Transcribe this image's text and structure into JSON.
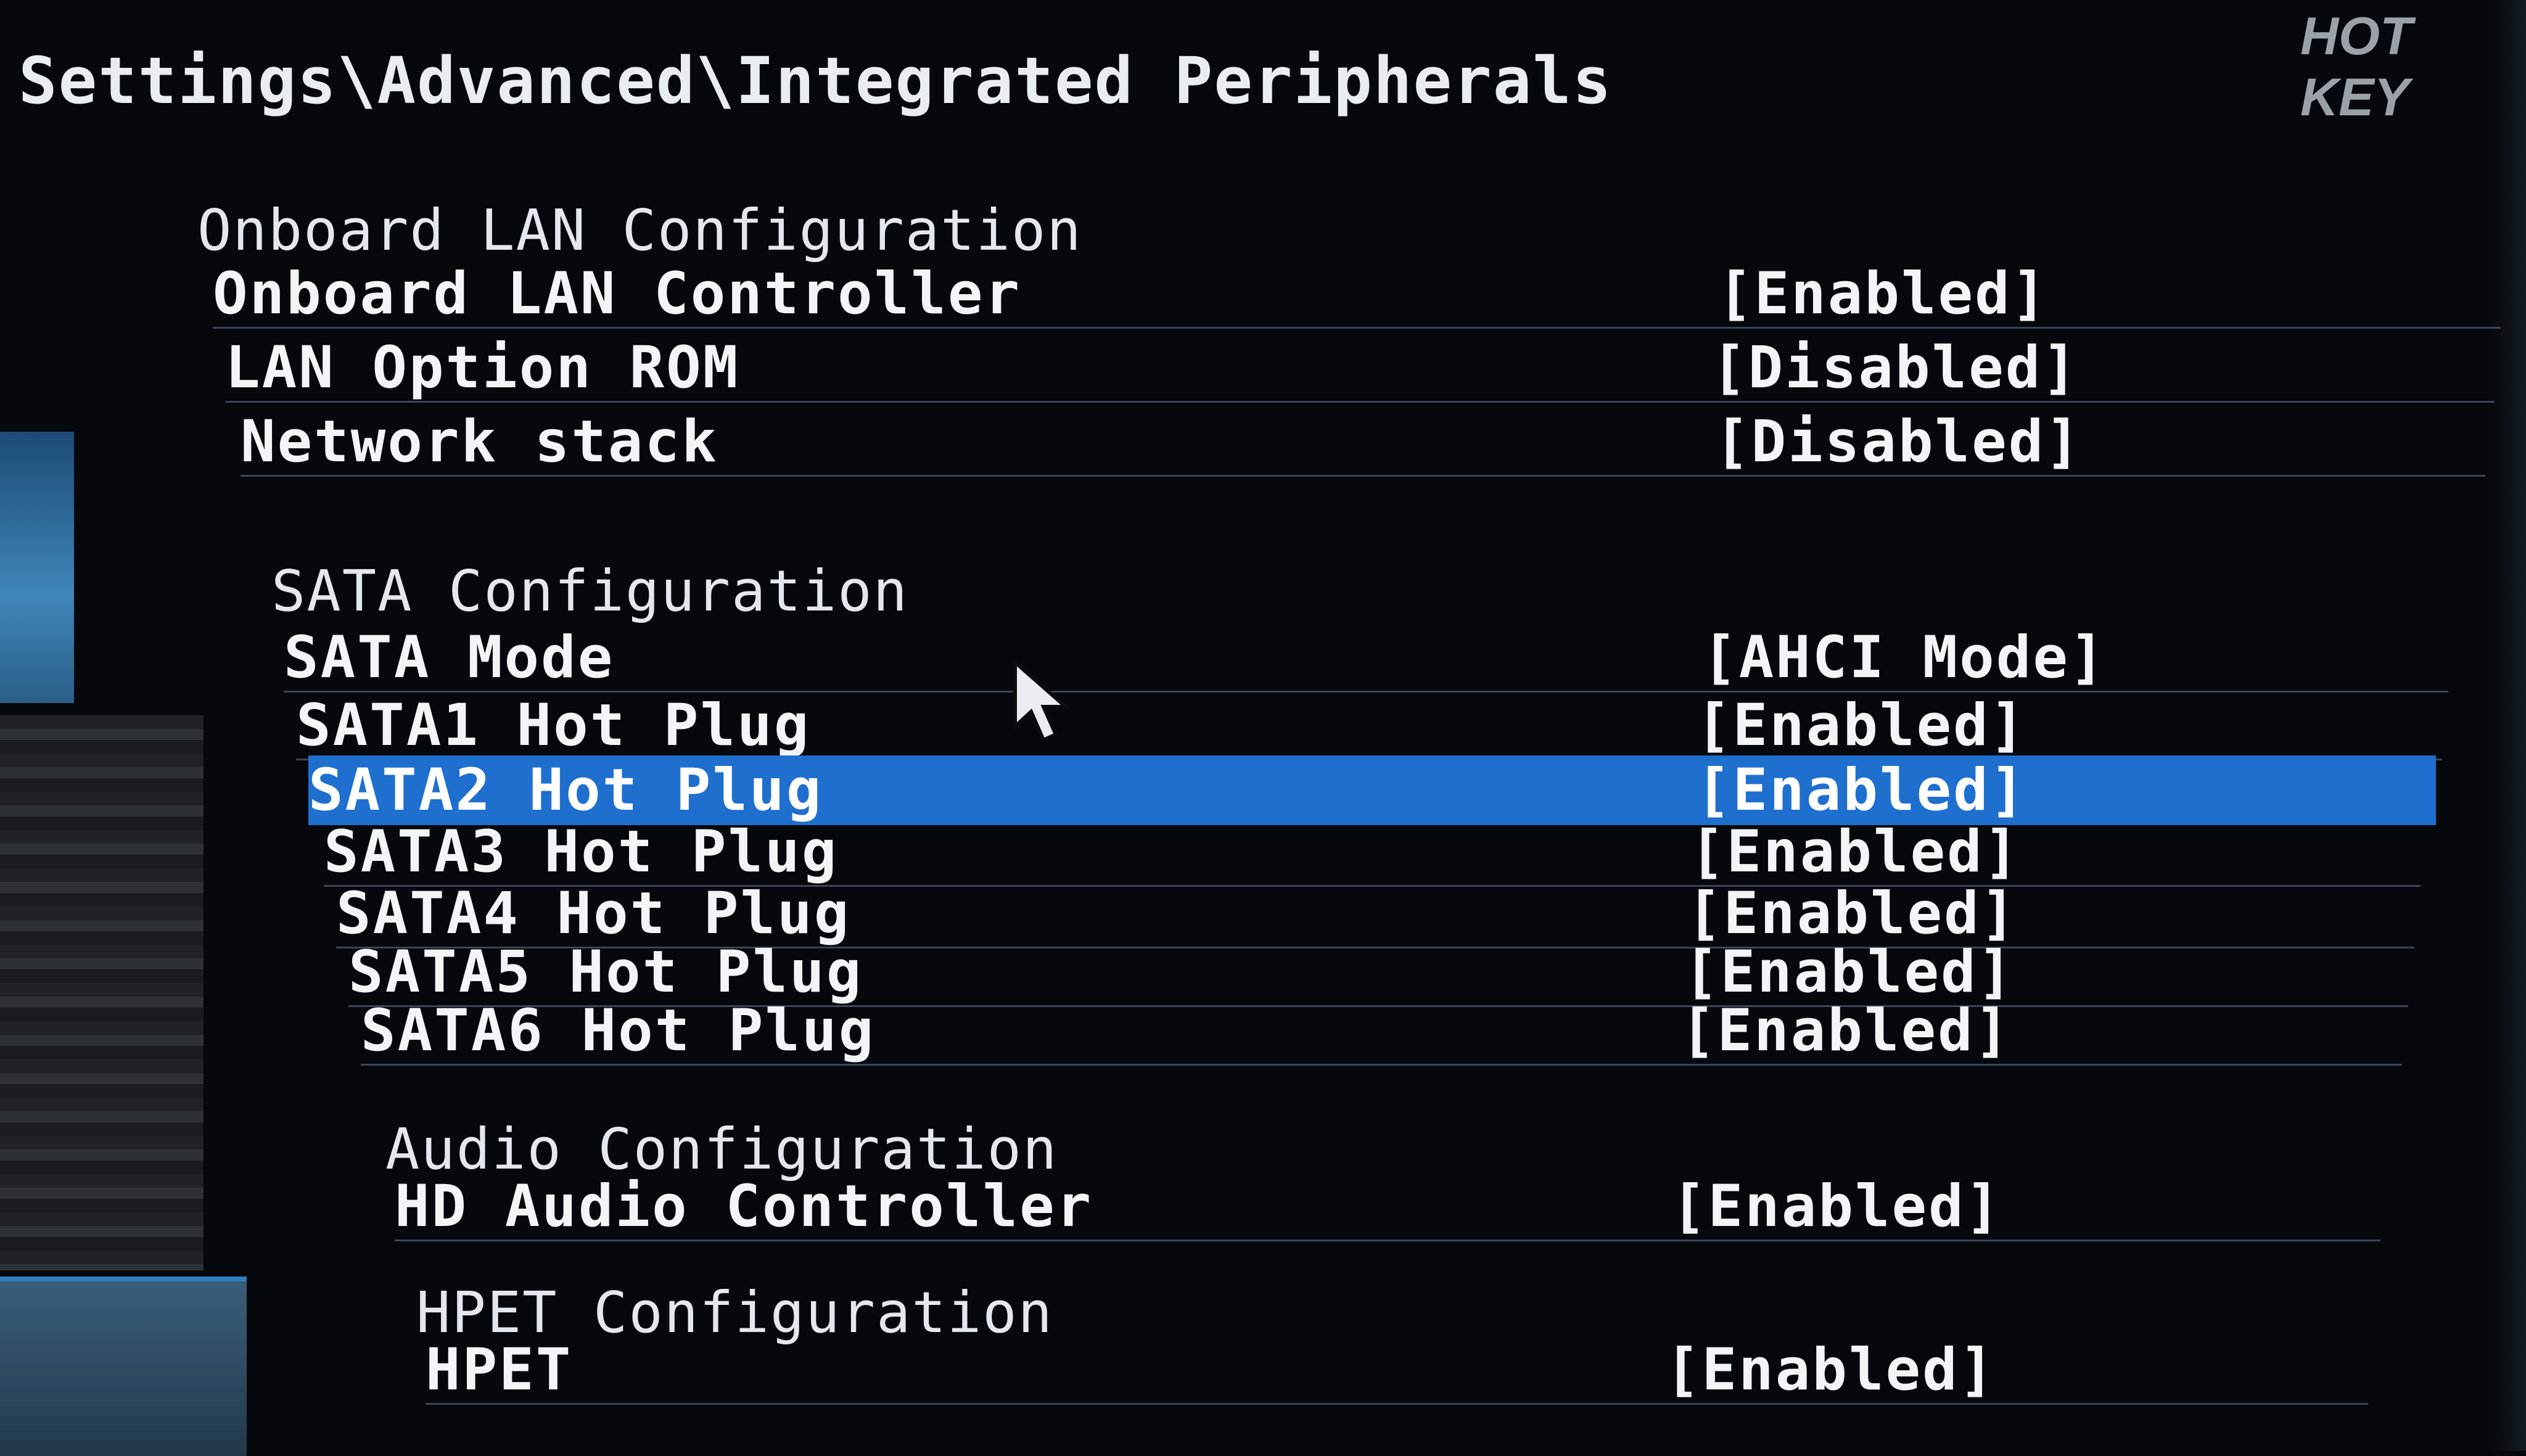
{
  "breadcrumb": "Settings\\Advanced\\Integrated Peripherals",
  "hotkey_label": "HOT KEY",
  "lan": {
    "header": "Onboard LAN Configuration",
    "items": [
      {
        "label": "Onboard LAN Controller",
        "value": "[Enabled]"
      },
      {
        "label": "LAN Option ROM",
        "value": "[Disabled]"
      },
      {
        "label": "Network stack",
        "value": "[Disabled]"
      }
    ]
  },
  "sata": {
    "header": "SATA Configuration",
    "items": [
      {
        "label": "SATA Mode",
        "value": "[AHCI Mode]"
      },
      {
        "label": "SATA1 Hot Plug",
        "value": "[Enabled]"
      },
      {
        "label": "SATA2 Hot Plug",
        "value": "[Enabled]",
        "selected": true
      },
      {
        "label": "SATA3 Hot Plug",
        "value": "[Enabled]"
      },
      {
        "label": "SATA4 Hot Plug",
        "value": "[Enabled]"
      },
      {
        "label": "SATA5 Hot Plug",
        "value": "[Enabled]"
      },
      {
        "label": "SATA6 Hot Plug",
        "value": "[Enabled]"
      }
    ]
  },
  "audio": {
    "header": "Audio Configuration",
    "items": [
      {
        "label": "HD Audio Controller",
        "value": "[Enabled]"
      }
    ]
  },
  "hpet": {
    "header": "HPET Configuration",
    "items": [
      {
        "label": "HPET",
        "value": "[Enabled]"
      }
    ]
  },
  "colors": {
    "background": "#05080c",
    "selection": "#1f6fcf",
    "text": "#f2f5f8"
  }
}
